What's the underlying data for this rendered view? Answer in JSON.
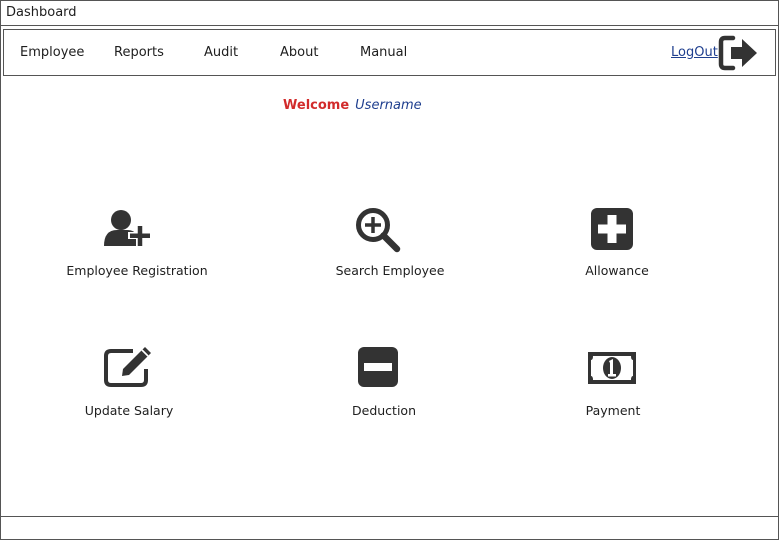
{
  "window": {
    "title": "Dashboard"
  },
  "nav": {
    "items": [
      {
        "label": "Employee"
      },
      {
        "label": "Reports"
      },
      {
        "label": "Audit"
      },
      {
        "label": "About"
      },
      {
        "label": "Manual"
      }
    ],
    "logout_label": "LogOut",
    "logout_icon": "logout-icon"
  },
  "welcome": {
    "label": "Welcome",
    "username": "Username"
  },
  "tiles": [
    {
      "label": "Employee Registration",
      "icon": "add-user-icon"
    },
    {
      "label": "Search Employee",
      "icon": "zoom-in-icon"
    },
    {
      "label": "Allowance",
      "icon": "plus-square-icon"
    },
    {
      "label": "Update Salary",
      "icon": "edit-icon"
    },
    {
      "label": "Deduction",
      "icon": "minus-square-icon"
    },
    {
      "label": "Payment",
      "icon": "money-bill-icon"
    }
  ],
  "colors": {
    "welcome": "#d22b2b",
    "link": "#1f3f8f",
    "icon": "#333333"
  }
}
